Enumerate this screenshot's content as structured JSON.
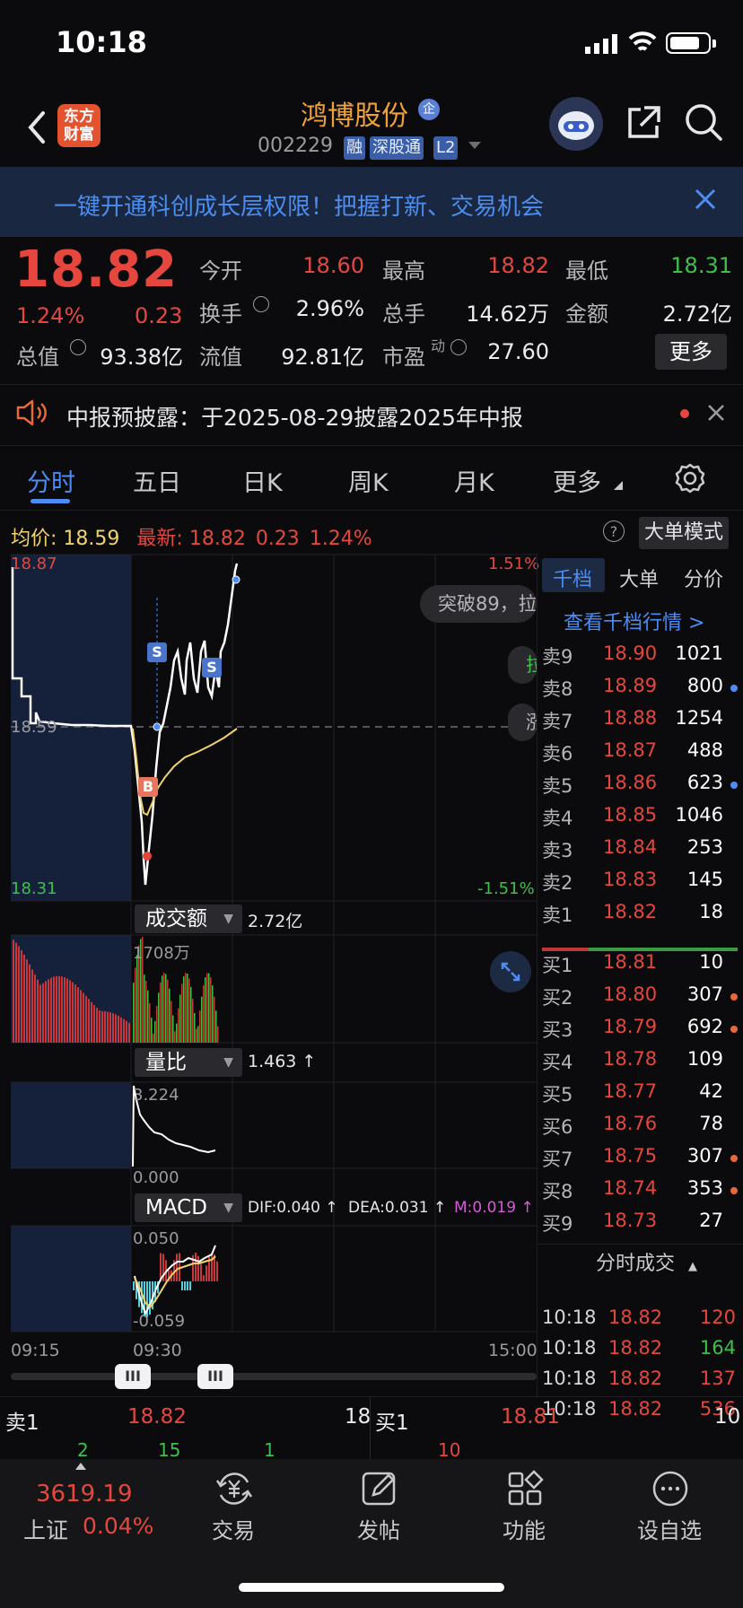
{
  "status_bar": {
    "time": "10:18"
  },
  "header": {
    "logo_line1": "东方",
    "logo_line2": "财富",
    "stock_name": "鸿博股份",
    "qi_badge": "企",
    "code": "002229",
    "tags": [
      "融",
      "深股通",
      "L2"
    ]
  },
  "banner": {
    "text": "一键开通科创成长层权限！把握打新、交易机会"
  },
  "quote": {
    "price": "18.82",
    "pct": "1.24%",
    "change": "0.23",
    "open_label": "今开",
    "open": "18.60",
    "high_label": "最高",
    "high": "18.82",
    "low_label": "最低",
    "low": "18.31",
    "turnover_label": "换手",
    "turnover": "2.96%",
    "volume_label": "总手",
    "volume": "14.62万",
    "amount_label": "金额",
    "amount": "2.72亿",
    "mcap_label": "总值",
    "mcap": "93.38亿",
    "float_label": "流值",
    "float": "92.81亿",
    "pe_label": "市盈",
    "pe_sup": "动",
    "pe": "27.60",
    "more_label": "更多"
  },
  "notice": {
    "text": "中报预披露：于2025-08-29披露2025年中报"
  },
  "tabs": [
    "分时",
    "五日",
    "日K",
    "周K",
    "月K",
    "更多"
  ],
  "chart_info": {
    "avg_label": "均价:",
    "avg_value": "18.59",
    "latest_label": "最新:",
    "latest_price": "18.82",
    "latest_change": "0.23",
    "latest_pct": "1.24%",
    "help": "?",
    "big_order_mode": "大单模式"
  },
  "price_chart": {
    "y_top": "18.87",
    "y_mid": "18.59",
    "y_bottom": "18.31",
    "pct_top": "1.51%",
    "pct_bottom": "-1.51%",
    "pill1": "突破89，拉",
    "pill2": "拉",
    "pill3": "涨",
    "marker_s": "S",
    "marker_b": "B"
  },
  "amount_panel": {
    "label": "成交额",
    "value": "2.72亿",
    "max": "1708万"
  },
  "ratio_panel": {
    "label": "量比",
    "value": "1.463 ↑",
    "max": "3.224",
    "min": "0.000"
  },
  "macd_panel": {
    "label": "MACD",
    "dif": "DIF:0.040 ↑",
    "dea": "DEA:0.031 ↑",
    "m": "M:0.019 ↑",
    "max": "0.050",
    "min": "-0.059"
  },
  "time_axis": [
    "09:15",
    "09:30",
    "15:00"
  ],
  "slider_handle": "III",
  "order_book": {
    "tabs": [
      "千档",
      "大单",
      "分价"
    ],
    "link": "查看千档行情 >",
    "asks": [
      {
        "label": "卖9",
        "price": "18.90",
        "vol": "1021",
        "dot": ""
      },
      {
        "label": "卖8",
        "price": "18.89",
        "vol": "800",
        "dot": "#4b8cf5"
      },
      {
        "label": "卖7",
        "price": "18.88",
        "vol": "1254",
        "dot": ""
      },
      {
        "label": "卖6",
        "price": "18.87",
        "vol": "488",
        "dot": ""
      },
      {
        "label": "卖5",
        "price": "18.86",
        "vol": "623",
        "dot": "#4b8cf5"
      },
      {
        "label": "卖4",
        "price": "18.85",
        "vol": "1046",
        "dot": ""
      },
      {
        "label": "卖3",
        "price": "18.84",
        "vol": "253",
        "dot": ""
      },
      {
        "label": "卖2",
        "price": "18.83",
        "vol": "145",
        "dot": ""
      },
      {
        "label": "卖1",
        "price": "18.82",
        "vol": "18",
        "dot": ""
      }
    ],
    "bids": [
      {
        "label": "买1",
        "price": "18.81",
        "vol": "10",
        "dot": ""
      },
      {
        "label": "买2",
        "price": "18.80",
        "vol": "307",
        "dot": "#e8683a"
      },
      {
        "label": "买3",
        "price": "18.79",
        "vol": "692",
        "dot": "#e8683a"
      },
      {
        "label": "买4",
        "price": "18.78",
        "vol": "109",
        "dot": ""
      },
      {
        "label": "买5",
        "price": "18.77",
        "vol": "42",
        "dot": ""
      },
      {
        "label": "买6",
        "price": "18.76",
        "vol": "78",
        "dot": ""
      },
      {
        "label": "买7",
        "price": "18.75",
        "vol": "307",
        "dot": "#e8683a"
      },
      {
        "label": "买8",
        "price": "18.74",
        "vol": "353",
        "dot": "#e8683a"
      },
      {
        "label": "买9",
        "price": "18.73",
        "vol": "27",
        "dot": ""
      }
    ]
  },
  "ticks": {
    "title": "分时成交",
    "rows": [
      {
        "time": "10:18",
        "price": "18.82",
        "vol": "120",
        "color": "#e5473f"
      },
      {
        "time": "10:18",
        "price": "18.82",
        "vol": "164",
        "color": "#3cc04a"
      },
      {
        "time": "10:18",
        "price": "18.82",
        "vol": "137",
        "color": "#e5473f"
      },
      {
        "time": "10:18",
        "price": "18.82",
        "vol": "536",
        "color": "#e5473f"
      }
    ]
  },
  "level_row": {
    "ask_label": "卖1",
    "ask_price": "18.82",
    "ask_vol": "18",
    "bid_label": "买1",
    "bid_price": "18.81",
    "bid_vol": "10",
    "partial": [
      "2",
      "15",
      "1",
      "10"
    ]
  },
  "bottom_nav": {
    "index_value": "3619.19",
    "index_name": "上证",
    "index_pct": "0.04%",
    "items": [
      "交易",
      "发帖",
      "功能",
      "设自选"
    ]
  },
  "colors": {
    "up": "#e5473f",
    "down": "#3cc04a",
    "accent": "#4b8cf5",
    "avg_line": "#f2d36b"
  }
}
